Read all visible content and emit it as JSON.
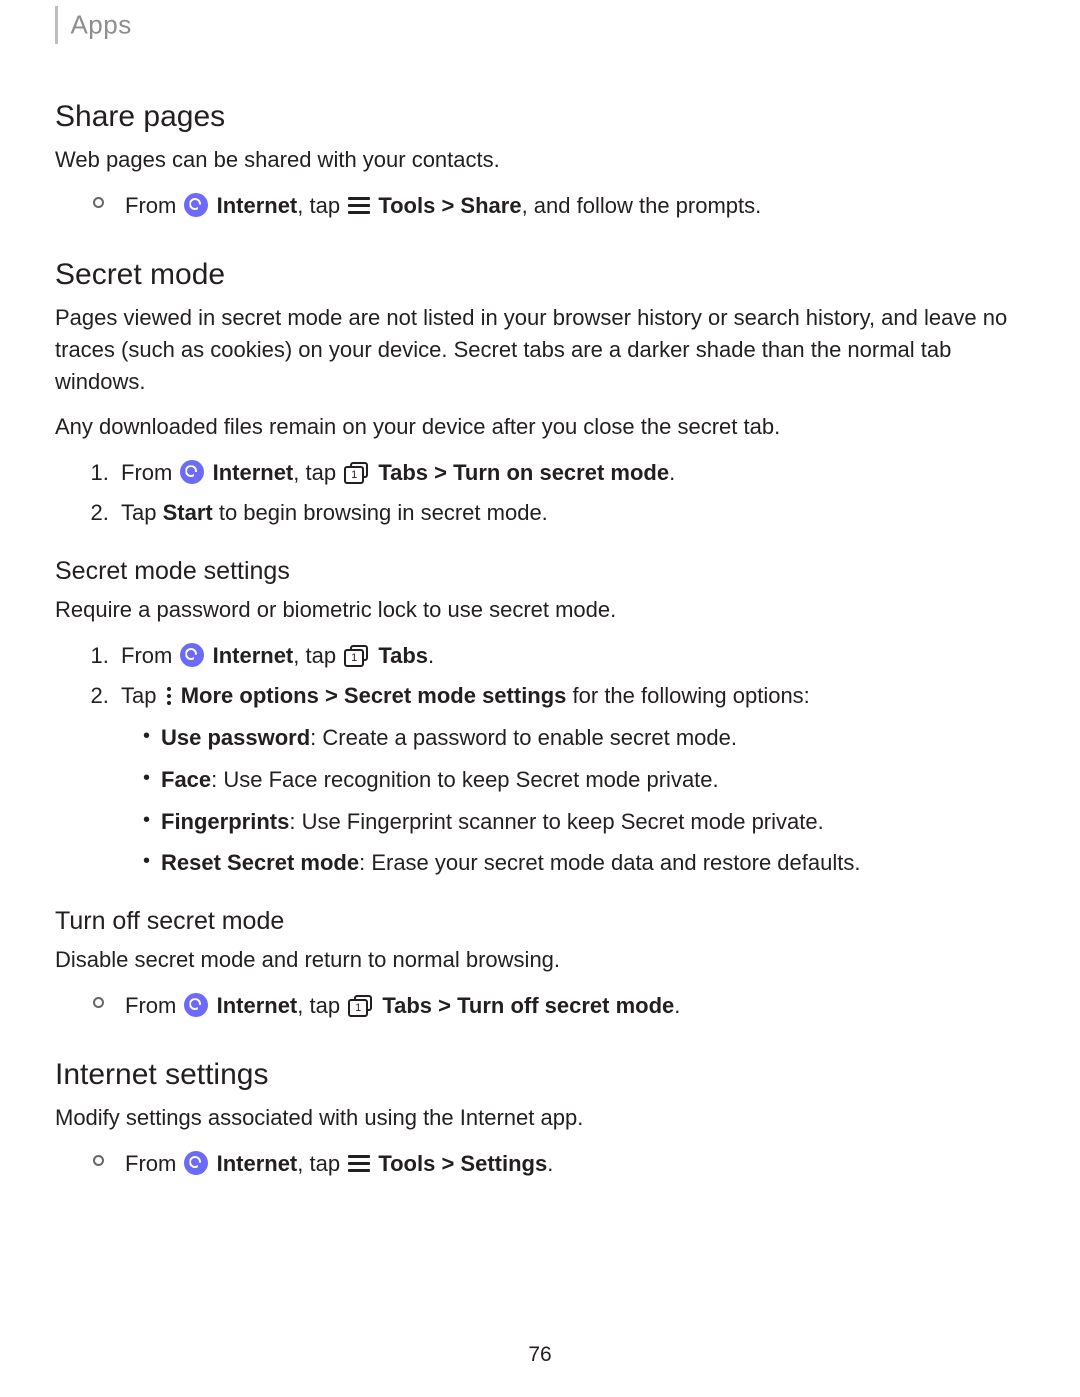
{
  "header": {
    "section_label": "Apps"
  },
  "share_pages": {
    "heading": "Share pages",
    "intro": "Web pages can be shared with your contacts.",
    "step": {
      "prefix": "From ",
      "internet_label": "Internet",
      "tap_word": ", tap ",
      "tools_label": "Tools",
      "sep": " > ",
      "share_label": "Share",
      "suffix": ", and follow the prompts."
    }
  },
  "secret_mode": {
    "heading": "Secret mode",
    "para1": "Pages viewed in secret mode are not listed in your browser history or search history, and leave no traces (such as cookies) on your device. Secret tabs are a darker shade than the normal tab windows.",
    "para2": "Any downloaded files remain on your device after you close the secret tab.",
    "steps": {
      "s1": {
        "prefix": "From ",
        "internet_label": "Internet",
        "tap_word": ", tap ",
        "tabs_label": "Tabs",
        "sep": " > ",
        "action": "Turn on secret mode",
        "period": "."
      },
      "s2": {
        "prefix": "Tap ",
        "start_label": "Start",
        "suffix": " to begin browsing in secret mode."
      }
    }
  },
  "secret_settings": {
    "heading": "Secret mode settings",
    "intro": "Require a password or biometric lock to use secret mode.",
    "steps": {
      "s1": {
        "prefix": "From ",
        "internet_label": "Internet",
        "tap_word": ", tap ",
        "tabs_label": "Tabs",
        "period": "."
      },
      "s2": {
        "prefix": "Tap ",
        "more_label": "More options",
        "sep": " > ",
        "sm_settings": "Secret mode settings",
        "suffix": " for the following options:"
      }
    },
    "options": {
      "o1_bold": "Use password",
      "o1_rest": ": Create a password to enable secret mode.",
      "o2_bold": "Face",
      "o2_rest": ": Use Face recognition to keep Secret mode private.",
      "o3_bold": "Fingerprints",
      "o3_rest": ": Use Fingerprint scanner to keep Secret mode private.",
      "o4_bold": "Reset Secret mode",
      "o4_rest": ": Erase your secret mode data and restore defaults."
    }
  },
  "turn_off": {
    "heading": "Turn off secret mode",
    "intro": "Disable secret mode and return to normal browsing.",
    "step": {
      "prefix": "From ",
      "internet_label": "Internet",
      "tap_word": ", tap ",
      "tabs_label": "Tabs",
      "sep": " > ",
      "action": "Turn off secret mode",
      "period": "."
    }
  },
  "internet_settings": {
    "heading": "Internet settings",
    "intro": "Modify settings associated with using the Internet app.",
    "step": {
      "prefix": "From ",
      "internet_label": "Internet",
      "tap_word": ", tap ",
      "tools_label": "Tools",
      "sep": " > ",
      "settings_label": "Settings",
      "period": "."
    }
  },
  "footer": {
    "page_number": "76"
  }
}
